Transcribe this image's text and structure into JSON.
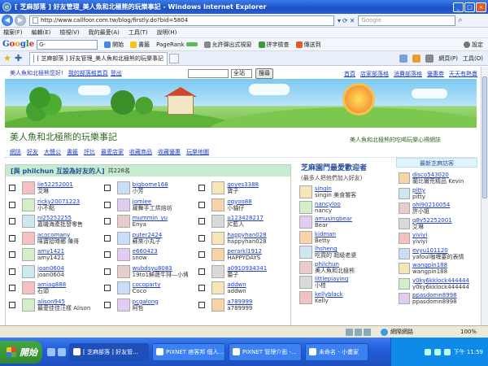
{
  "window": {
    "title": "[ 芝麻部落 ] 好友管理_美人魚和北極熊的玩樂事記 - Windows Internet Explorer",
    "url": "http://www.callfoor.com.tw/blog/firstly.do?bid=5804",
    "search_placeholder": "Google"
  },
  "menu": [
    "檔案(F)",
    "編輯(E)",
    "檢視(V)",
    "我的最愛(A)",
    "工具(T)",
    "說明(H)"
  ],
  "googlebar": {
    "logo": [
      "G",
      "o",
      "o",
      "g",
      "l",
      "e"
    ],
    "search_value": "G-",
    "items": [
      "開始",
      "書籤",
      "PageRank",
      "允許彈出式視窗",
      "拼字檢查",
      "傳送到",
      "設定"
    ]
  },
  "tab": {
    "label": "[ 芝麻部落 ] 好友管理_美人魚和北極熊的玩樂事記",
    "tools": [
      "網頁(P)",
      "工具(O)"
    ]
  },
  "topstrip": {
    "greeting": "美人魚和北極熊您好!",
    "links": [
      "我的部落格首頁",
      "登出"
    ],
    "select": "全站",
    "search_button": "搜尋",
    "right_links": [
      "首頁",
      "店家部落格",
      "消費部落格",
      "優惠券",
      "天天有熱賣"
    ]
  },
  "blog": {
    "title": "美人魚和北極熊的玩樂事記",
    "description": "美人魚和北極熊的吃喝玩樂心得網誌",
    "nav": [
      "網誌",
      "好友",
      "大聲公",
      "書籤",
      "評比",
      "最愛店家",
      "收藏商品",
      "收藏優惠",
      "玩樂地圖"
    ]
  },
  "friends": {
    "title": "[與 philchun 互設為好友的人]",
    "count": "共228名",
    "rows": [
      [
        {
          "id": "lie52252001",
          "nick": "艾琳"
        },
        {
          "id": "bigbome168",
          "nick": "小芳"
        },
        {
          "id": "goyes3388",
          "nick": "寶子"
        }
      ],
      [
        {
          "id": "ricky20071223",
          "nick": "小不點"
        },
        {
          "id": "jomiee",
          "nick": "躍舞手工烘焙坊"
        },
        {
          "id": "oqyoo88",
          "nick": "小貓仔"
        }
      ],
      [
        {
          "id": "ni25252255",
          "nick": "嘉嘰海產批發零售"
        },
        {
          "id": "mummin_yu",
          "nick": "Enya"
        },
        {
          "id": "u123428217",
          "nick": "JC藍人"
        }
      ],
      [
        {
          "id": "acocomany",
          "nick": "味寶拾時鄉 陳哥"
        },
        {
          "id": "puter2424",
          "nick": "蘇來小丸子"
        },
        {
          "id": "happyhan028",
          "nick": "happyhan028"
        }
      ],
      [
        {
          "id": "amy1421",
          "nick": "amy1421"
        },
        {
          "id": "e660423",
          "nick": "snow"
        },
        {
          "id": "perarkl1912",
          "nick": "HAPPYDAYS"
        }
      ],
      [
        {
          "id": "joan0604",
          "nick": "joan0604"
        },
        {
          "id": "wubdsyu8083",
          "nick": "19to1鮮蔬牛排—小博"
        },
        {
          "id": "a0910934341",
          "nick": "蕾子"
        }
      ],
      [
        {
          "id": "amiag888",
          "nick": "石頭"
        },
        {
          "id": "cocoparty",
          "nick": "Coco"
        },
        {
          "id": "addwn",
          "nick": "addwn"
        }
      ],
      [
        {
          "id": "alison945",
          "nick": "最愛佳佳汪樣 Alison"
        },
        {
          "id": "pcgalong",
          "nick": "阿哲"
        },
        {
          "id": "a789999",
          "nick": "a789999"
        }
      ]
    ]
  },
  "favorites": {
    "title": "芝麻園門最愛歡迎者",
    "subtitle": "(最多人把他們加入好友)",
    "items": [
      {
        "id": "singin",
        "nick": "singin 美食饕客"
      },
      {
        "id": "nancyloo",
        "nick": "nancy"
      },
      {
        "id": "amusingbear",
        "nick": "Bear"
      },
      {
        "id": "kidman",
        "nick": "Betty"
      },
      {
        "id": "lhsheng",
        "nick": "吃貨的 超級老婆"
      },
      {
        "id": "philchun",
        "nick": "美人魚和北極熊"
      },
      {
        "id": "littlepiaying",
        "nick": "小桂"
      },
      {
        "id": "kellyblack",
        "nick": "Kelly"
      }
    ]
  },
  "visitors": {
    "title": "最新芝麻訪客",
    "items": [
      {
        "id": "disco543020",
        "nick": "蘭比爾荒精品 Kevin"
      },
      {
        "id": "pitty",
        "nick": "pitty"
      },
      {
        "id": "ohi90210054",
        "nick": "許小姐"
      },
      {
        "id": "q8v52252001",
        "nick": "艾琳"
      },
      {
        "id": "yiviyi",
        "nick": "yiviyi"
      },
      {
        "id": "evyu101120",
        "nick": "yafoul咖喱要的表情"
      },
      {
        "id": "wangpin188",
        "nick": "wangpin188"
      },
      {
        "id": "y0ky6kklock444444",
        "nick": "y0ky6kklock444444"
      },
      {
        "id": "ppasdomn8998",
        "nick": "ppasdomn8998"
      }
    ]
  },
  "status": {
    "zone": "網際網路",
    "zoom": "100%"
  },
  "taskbar": {
    "start": "開始",
    "tasks": [
      "[ 芝麻部落 ] 好友管...",
      "PIXNET 痞客邦 個人...",
      "PIXNET 管理介面 -...",
      "未命名 - 小畫家"
    ],
    "time": "下午 11:59"
  },
  "colors": {
    "friends_header_bg": "#c6ecd0",
    "link": "#1a3fcf",
    "blog_title": "#2d6b1e"
  }
}
